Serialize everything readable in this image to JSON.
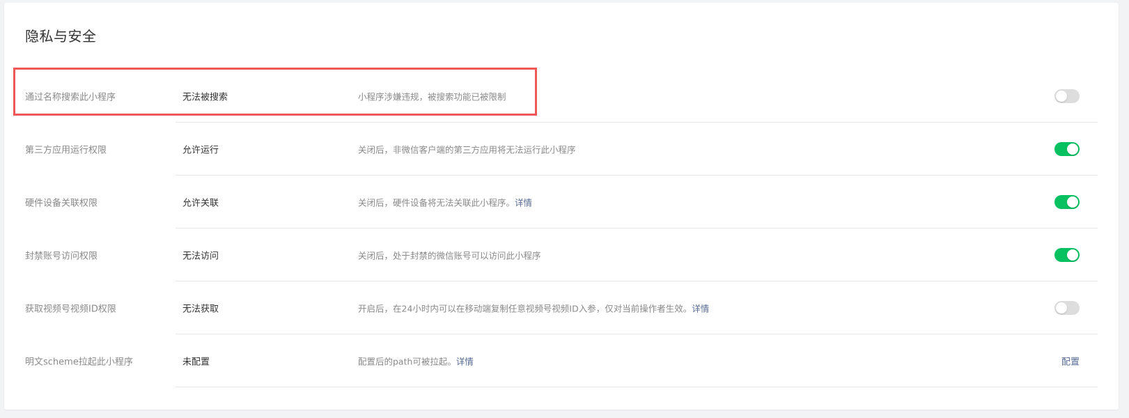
{
  "section": {
    "title": "隐私与安全"
  },
  "rows": [
    {
      "label": "通过名称搜索此小程序",
      "value": "无法被搜索",
      "desc": "小程序涉嫌违规，被搜索功能已被限制",
      "link": "",
      "toggle_state": "off"
    },
    {
      "label": "第三方应用运行权限",
      "value": "允许运行",
      "desc": "关闭后，非微信客户端的第三方应用将无法运行此小程序",
      "link": "",
      "toggle_state": "on"
    },
    {
      "label": "硬件设备关联权限",
      "value": "允许关联",
      "desc": "关闭后，硬件设备将无法关联此小程序。",
      "link": "详情",
      "toggle_state": "on"
    },
    {
      "label": "封禁账号访问权限",
      "value": "无法访问",
      "desc": "关闭后，处于封禁的微信账号可以访问此小程序",
      "link": "",
      "toggle_state": "on"
    },
    {
      "label": "获取视频号视频ID权限",
      "value": "无法获取",
      "desc": "开启后，在24小时内可以在移动端复制任意视频号视频ID入参，仅对当前操作者生效。",
      "link": "详情",
      "toggle_state": "off"
    },
    {
      "label": "明文scheme拉起此小程序",
      "value": "未配置",
      "desc": "配置后的path可被拉起。",
      "link": "详情",
      "action": "配置"
    }
  ],
  "colors": {
    "toggle_on": "#07c160",
    "toggle_off": "#dddddd",
    "link": "#576b95",
    "highlight_border": "#f05757"
  }
}
